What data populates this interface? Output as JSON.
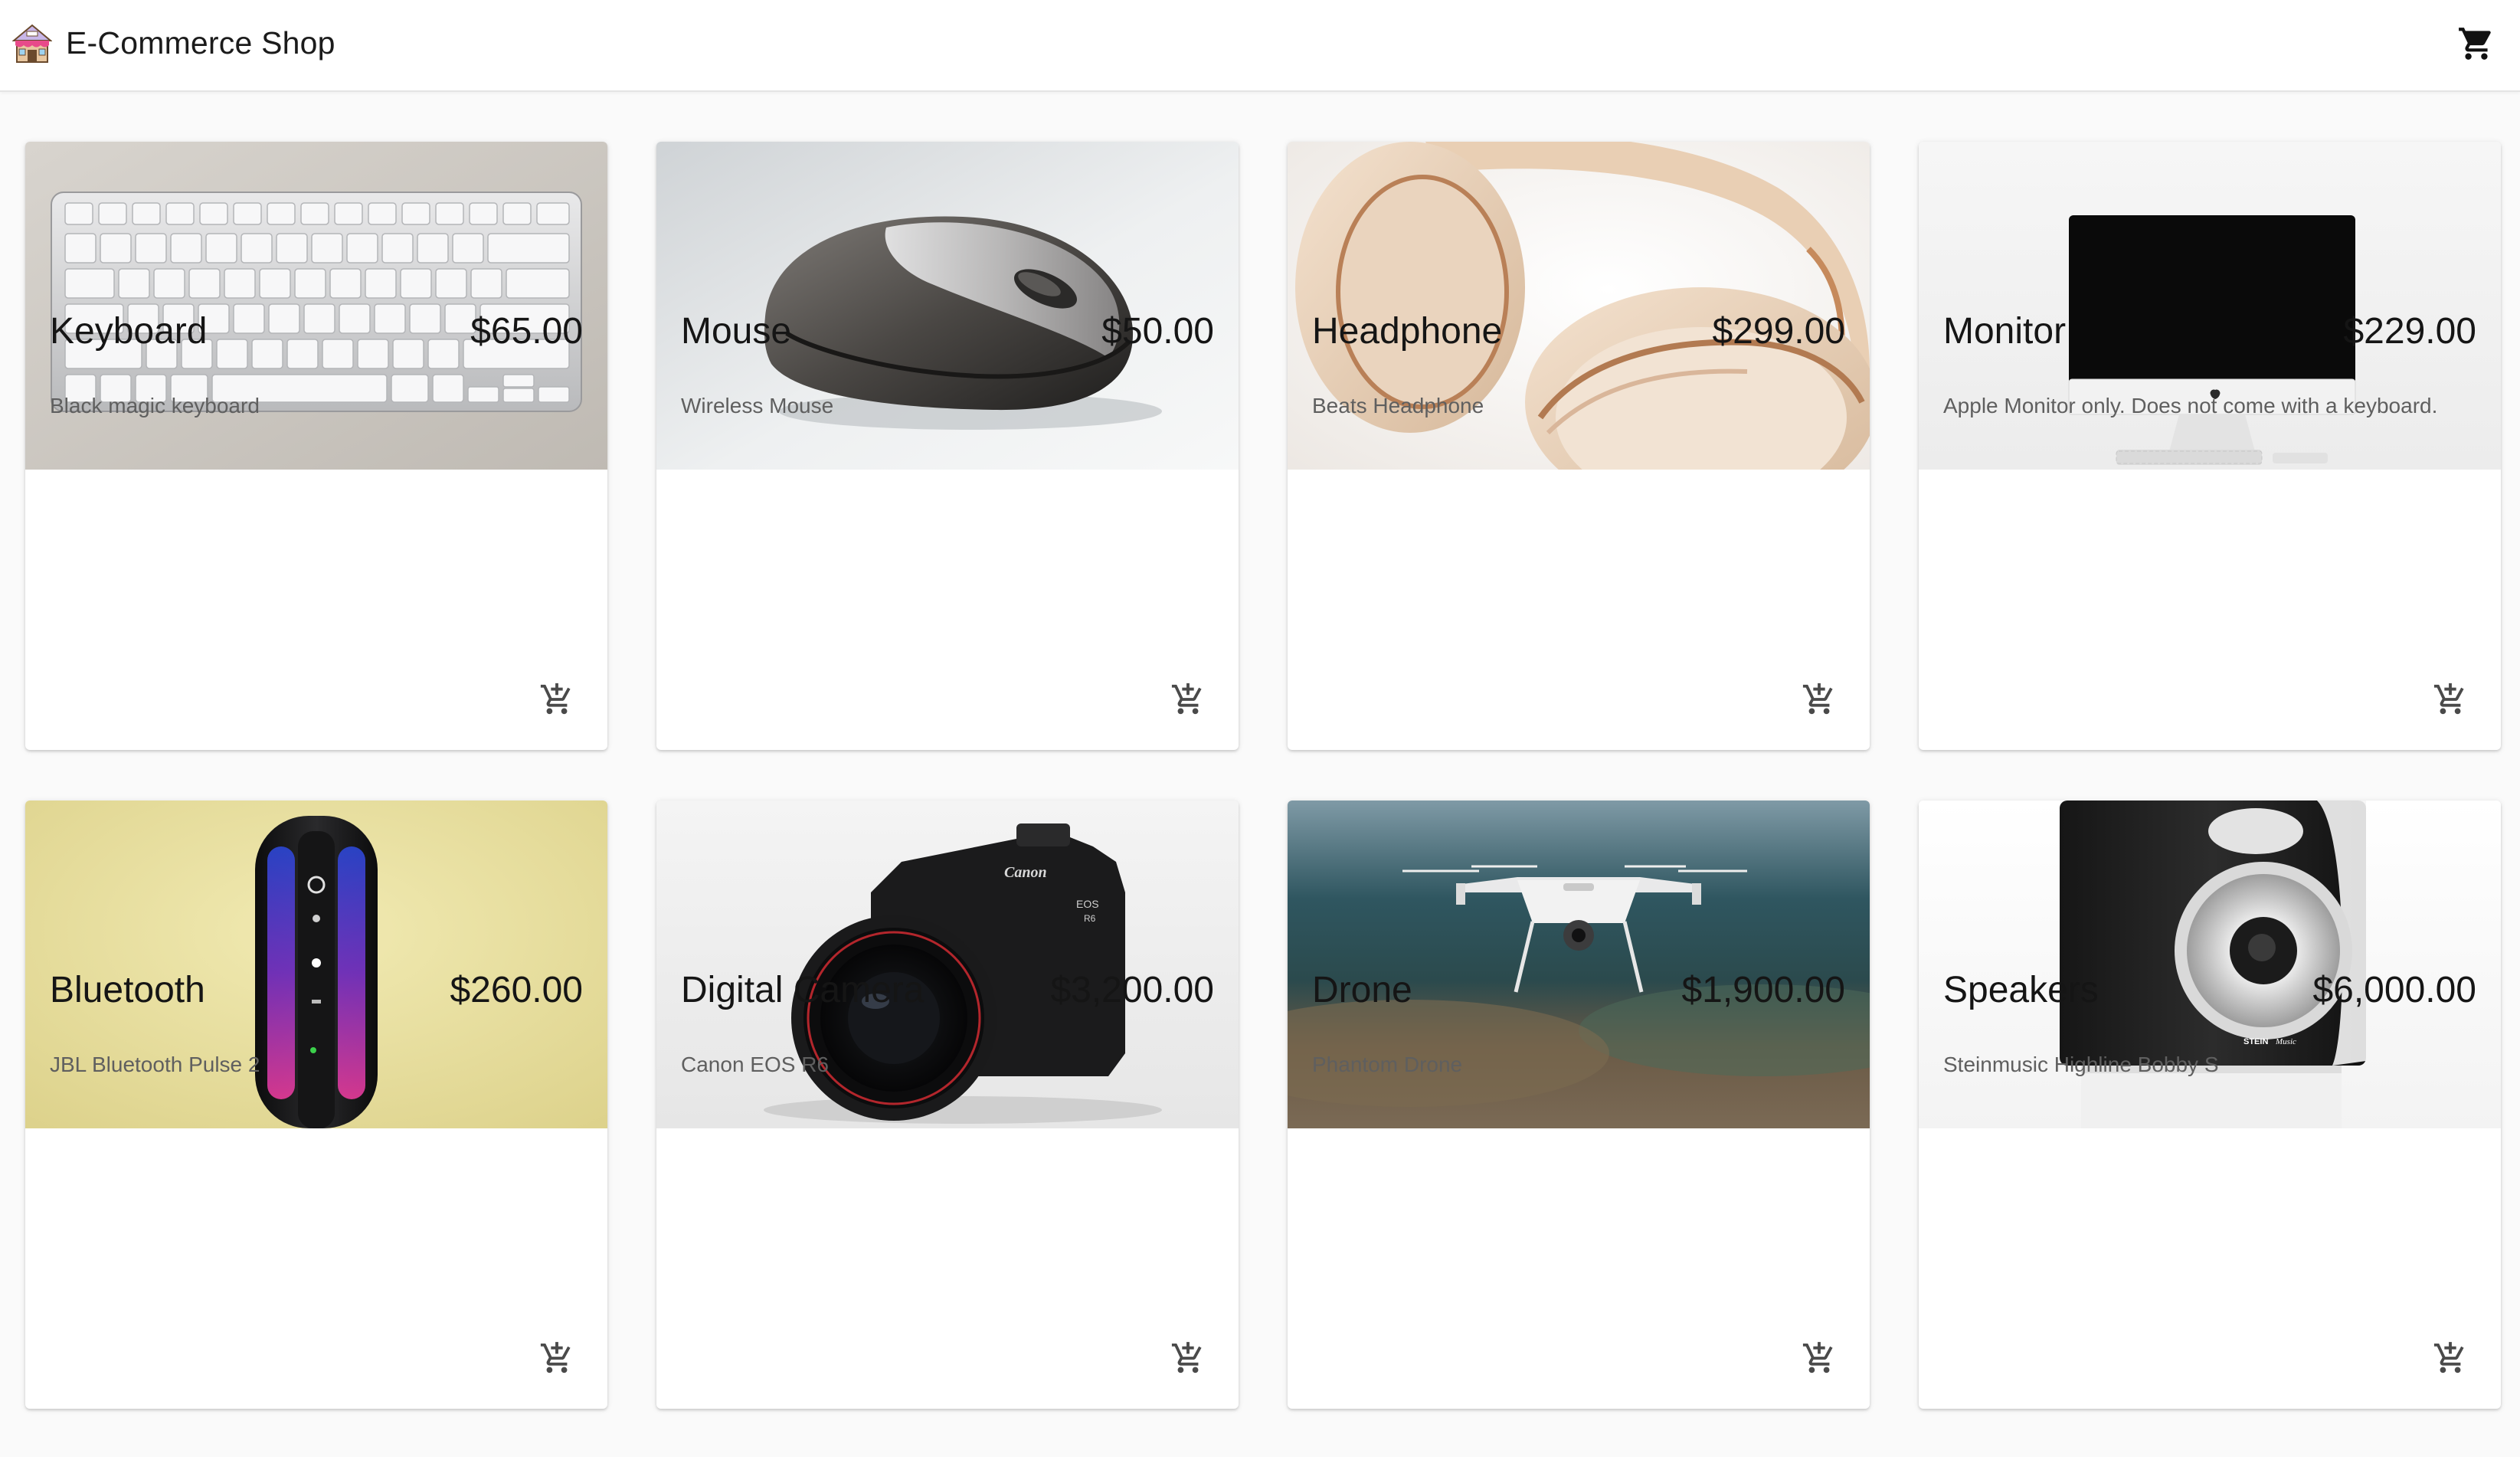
{
  "header": {
    "title": "E-Commerce Shop",
    "logo_icon": "shop-icon",
    "cart_icon": "cart-icon"
  },
  "products": [
    {
      "name": "Keyboard",
      "price": "$65.00",
      "description": "Black magic keyboard",
      "image": "keyboard"
    },
    {
      "name": "Mouse",
      "price": "$50.00",
      "description": "Wireless Mouse",
      "image": "mouse"
    },
    {
      "name": "Headphone",
      "price": "$299.00",
      "description": "Beats Headphone",
      "image": "headphones"
    },
    {
      "name": "Monitor",
      "price": "$229.00",
      "description": "Apple Monitor only. Does not come with a keyboard.",
      "image": "monitor"
    },
    {
      "name": "Bluetooth",
      "price": "$260.00",
      "description": "JBL Bluetooth Pulse 2",
      "image": "bluetooth-speaker"
    },
    {
      "name": "Digital Camera",
      "price": "$3,200.00",
      "description": "Canon EOS R6",
      "image": "camera"
    },
    {
      "name": "Drone",
      "price": "$1,900.00",
      "description": "Phantom Drone",
      "image": "drone"
    },
    {
      "name": "Speakers",
      "price": "$6,000.00",
      "description": "Steinmusic Highline Bobby S",
      "image": "speakers"
    }
  ],
  "colors": {
    "page_background": "#fafafa",
    "card_background": "#ffffff",
    "text_primary": "#151515",
    "text_secondary": "#5f5f5f"
  }
}
